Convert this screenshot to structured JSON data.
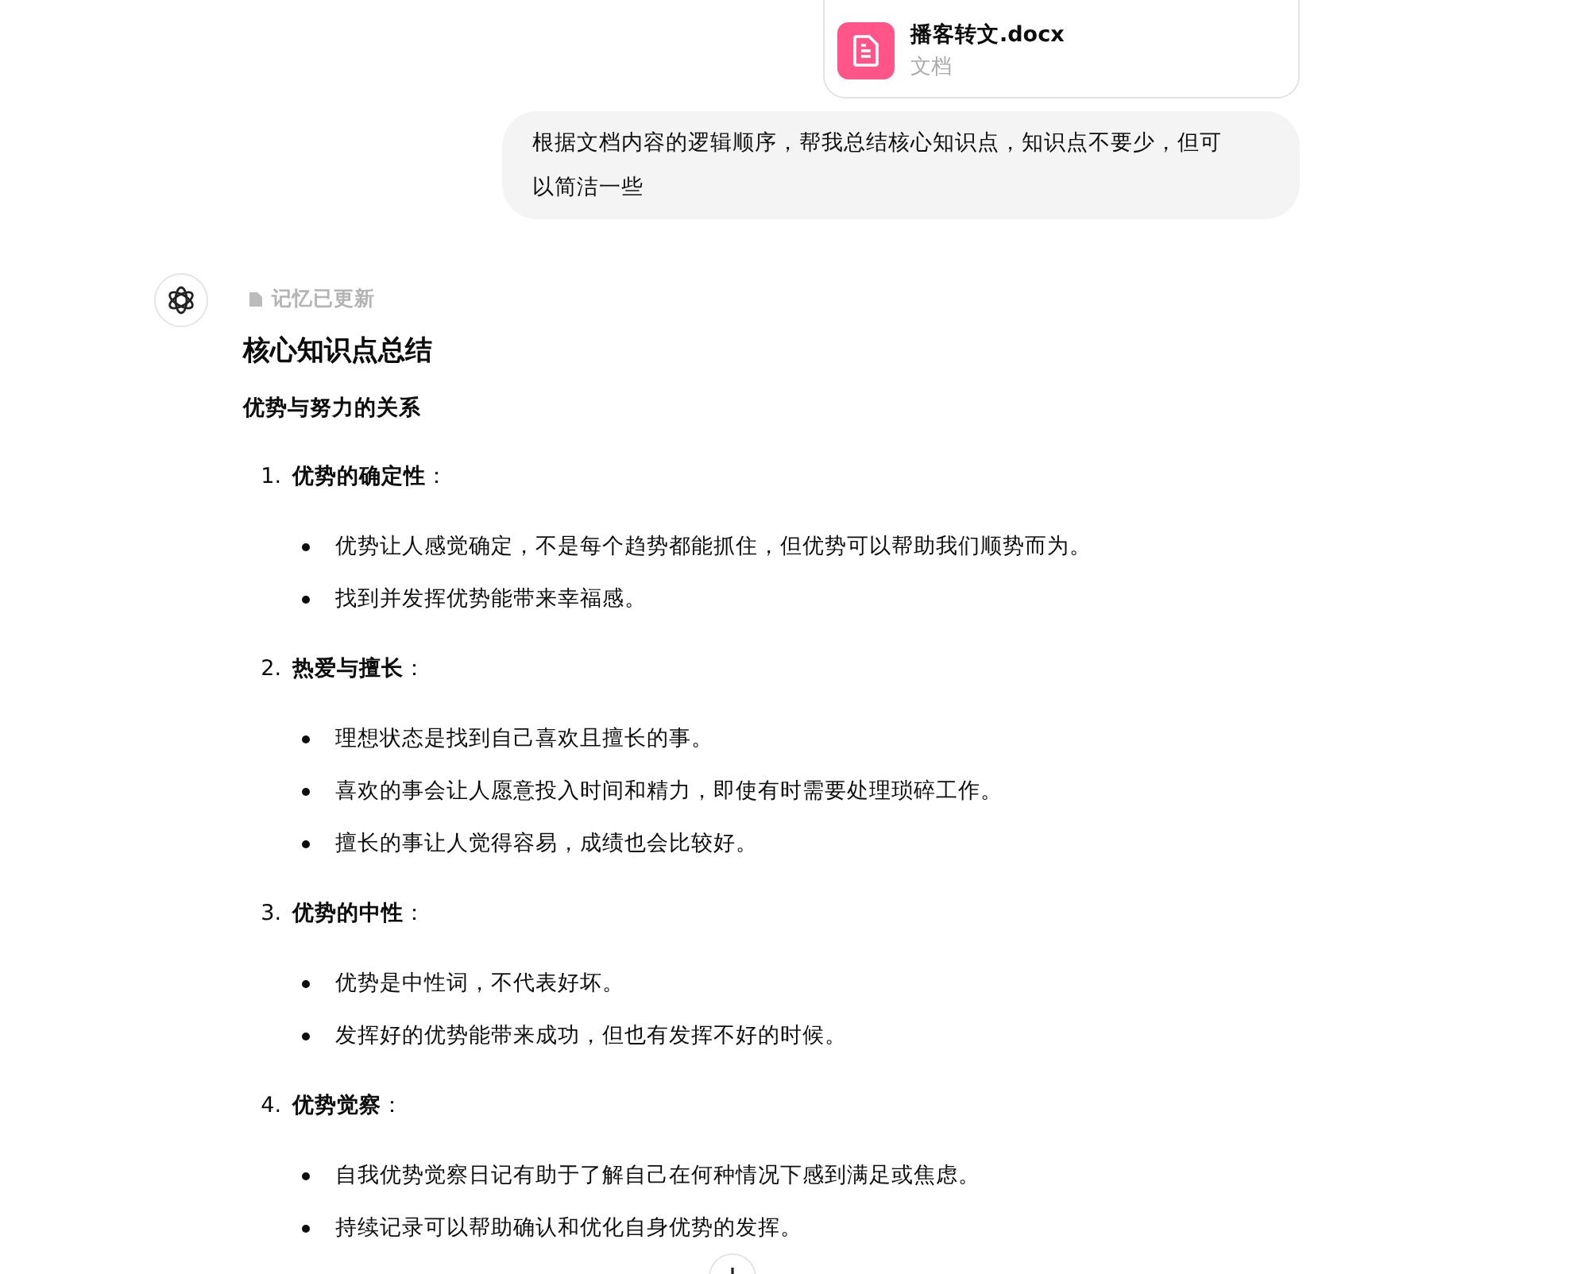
{
  "attachment": {
    "name": "播客转文.docx",
    "type": "文档"
  },
  "user_message": "根据文档内容的逻辑顺序，帮我总结核心知识点，知识点不要少，但可以简洁一些",
  "assistant": {
    "memory_note": "记忆已更新",
    "heading": "核心知识点总结",
    "subheading": "优势与努力的关系",
    "items": [
      {
        "number": "1.",
        "title": "优势的确定性",
        "suffix": "：",
        "bullets": [
          "优势让人感觉确定，不是每个趋势都能抓住，但优势可以帮助我们顺势而为。",
          "找到并发挥优势能带来幸福感。"
        ]
      },
      {
        "number": "2.",
        "title": "热爱与擅长",
        "suffix": "：",
        "bullets": [
          "理想状态是找到自己喜欢且擅长的事。",
          "喜欢的事会让人愿意投入时间和精力，即使有时需要处理琐碎工作。",
          "擅长的事让人觉得容易，成绩也会比较好。"
        ]
      },
      {
        "number": "3.",
        "title": "优势的中性",
        "suffix": "：",
        "bullets": [
          "优势是中性词，不代表好坏。",
          "发挥好的优势能带来成功，但也有发挥不好的时候。"
        ]
      },
      {
        "number": "4.",
        "title": "优势觉察",
        "suffix": "：",
        "bullets": [
          "自我优势觉察日记有助于了解自己在何种情况下感到满足或焦虑。",
          "持续记录可以帮助确认和优化自身优势的发挥。"
        ]
      }
    ]
  }
}
